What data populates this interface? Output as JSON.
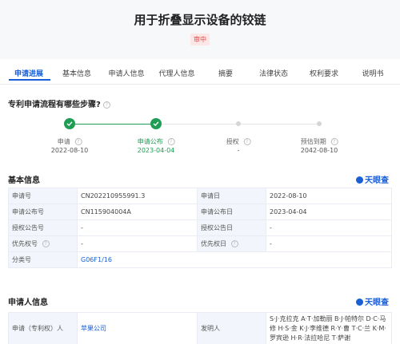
{
  "title": "用于折叠显示设备的铰链",
  "status": "审中",
  "tabs": [
    "申请进展",
    "基本信息",
    "申请人信息",
    "代理人信息",
    "摘要",
    "法律状态",
    "权利要求",
    "说明书"
  ],
  "progress": {
    "question": "专利申请流程有哪些步骤?",
    "steps": [
      {
        "label": "申请",
        "date": "2022-08-10"
      },
      {
        "label": "申请公布",
        "date": "2023-04-04"
      },
      {
        "label": "授权",
        "date": "-"
      },
      {
        "label": "预估到期",
        "date": "2042-08-10"
      }
    ]
  },
  "basic": {
    "title": "基本信息",
    "brand": "天眼查",
    "rows": [
      [
        "申请号",
        "CN202210955991.3",
        "申请日",
        "2022-08-10"
      ],
      [
        "申请公布号",
        "CN115904004A",
        "申请公布日",
        "2023-04-04"
      ],
      [
        "授权公告号",
        "-",
        "授权公告日",
        "-"
      ],
      [
        "优先权号",
        "-",
        "优先权日",
        "-"
      ]
    ],
    "class_label": "分类号",
    "class_value": "G06F1/16"
  },
  "applicant": {
    "title": "申请人信息",
    "brand": "天眼查",
    "label": "申请（专利权）人",
    "value": "苹果公司",
    "inventor_label": "发明人",
    "inventors": "S·J·克拉克 A·T·加勒丽 B·J·帕特尔 D·C·马修 H·S·金 K·J·李维德 R·Y·曹 T·C·兰 K·M·罗宾逊 H·R·法拉哈尼 T·萨谢"
  }
}
